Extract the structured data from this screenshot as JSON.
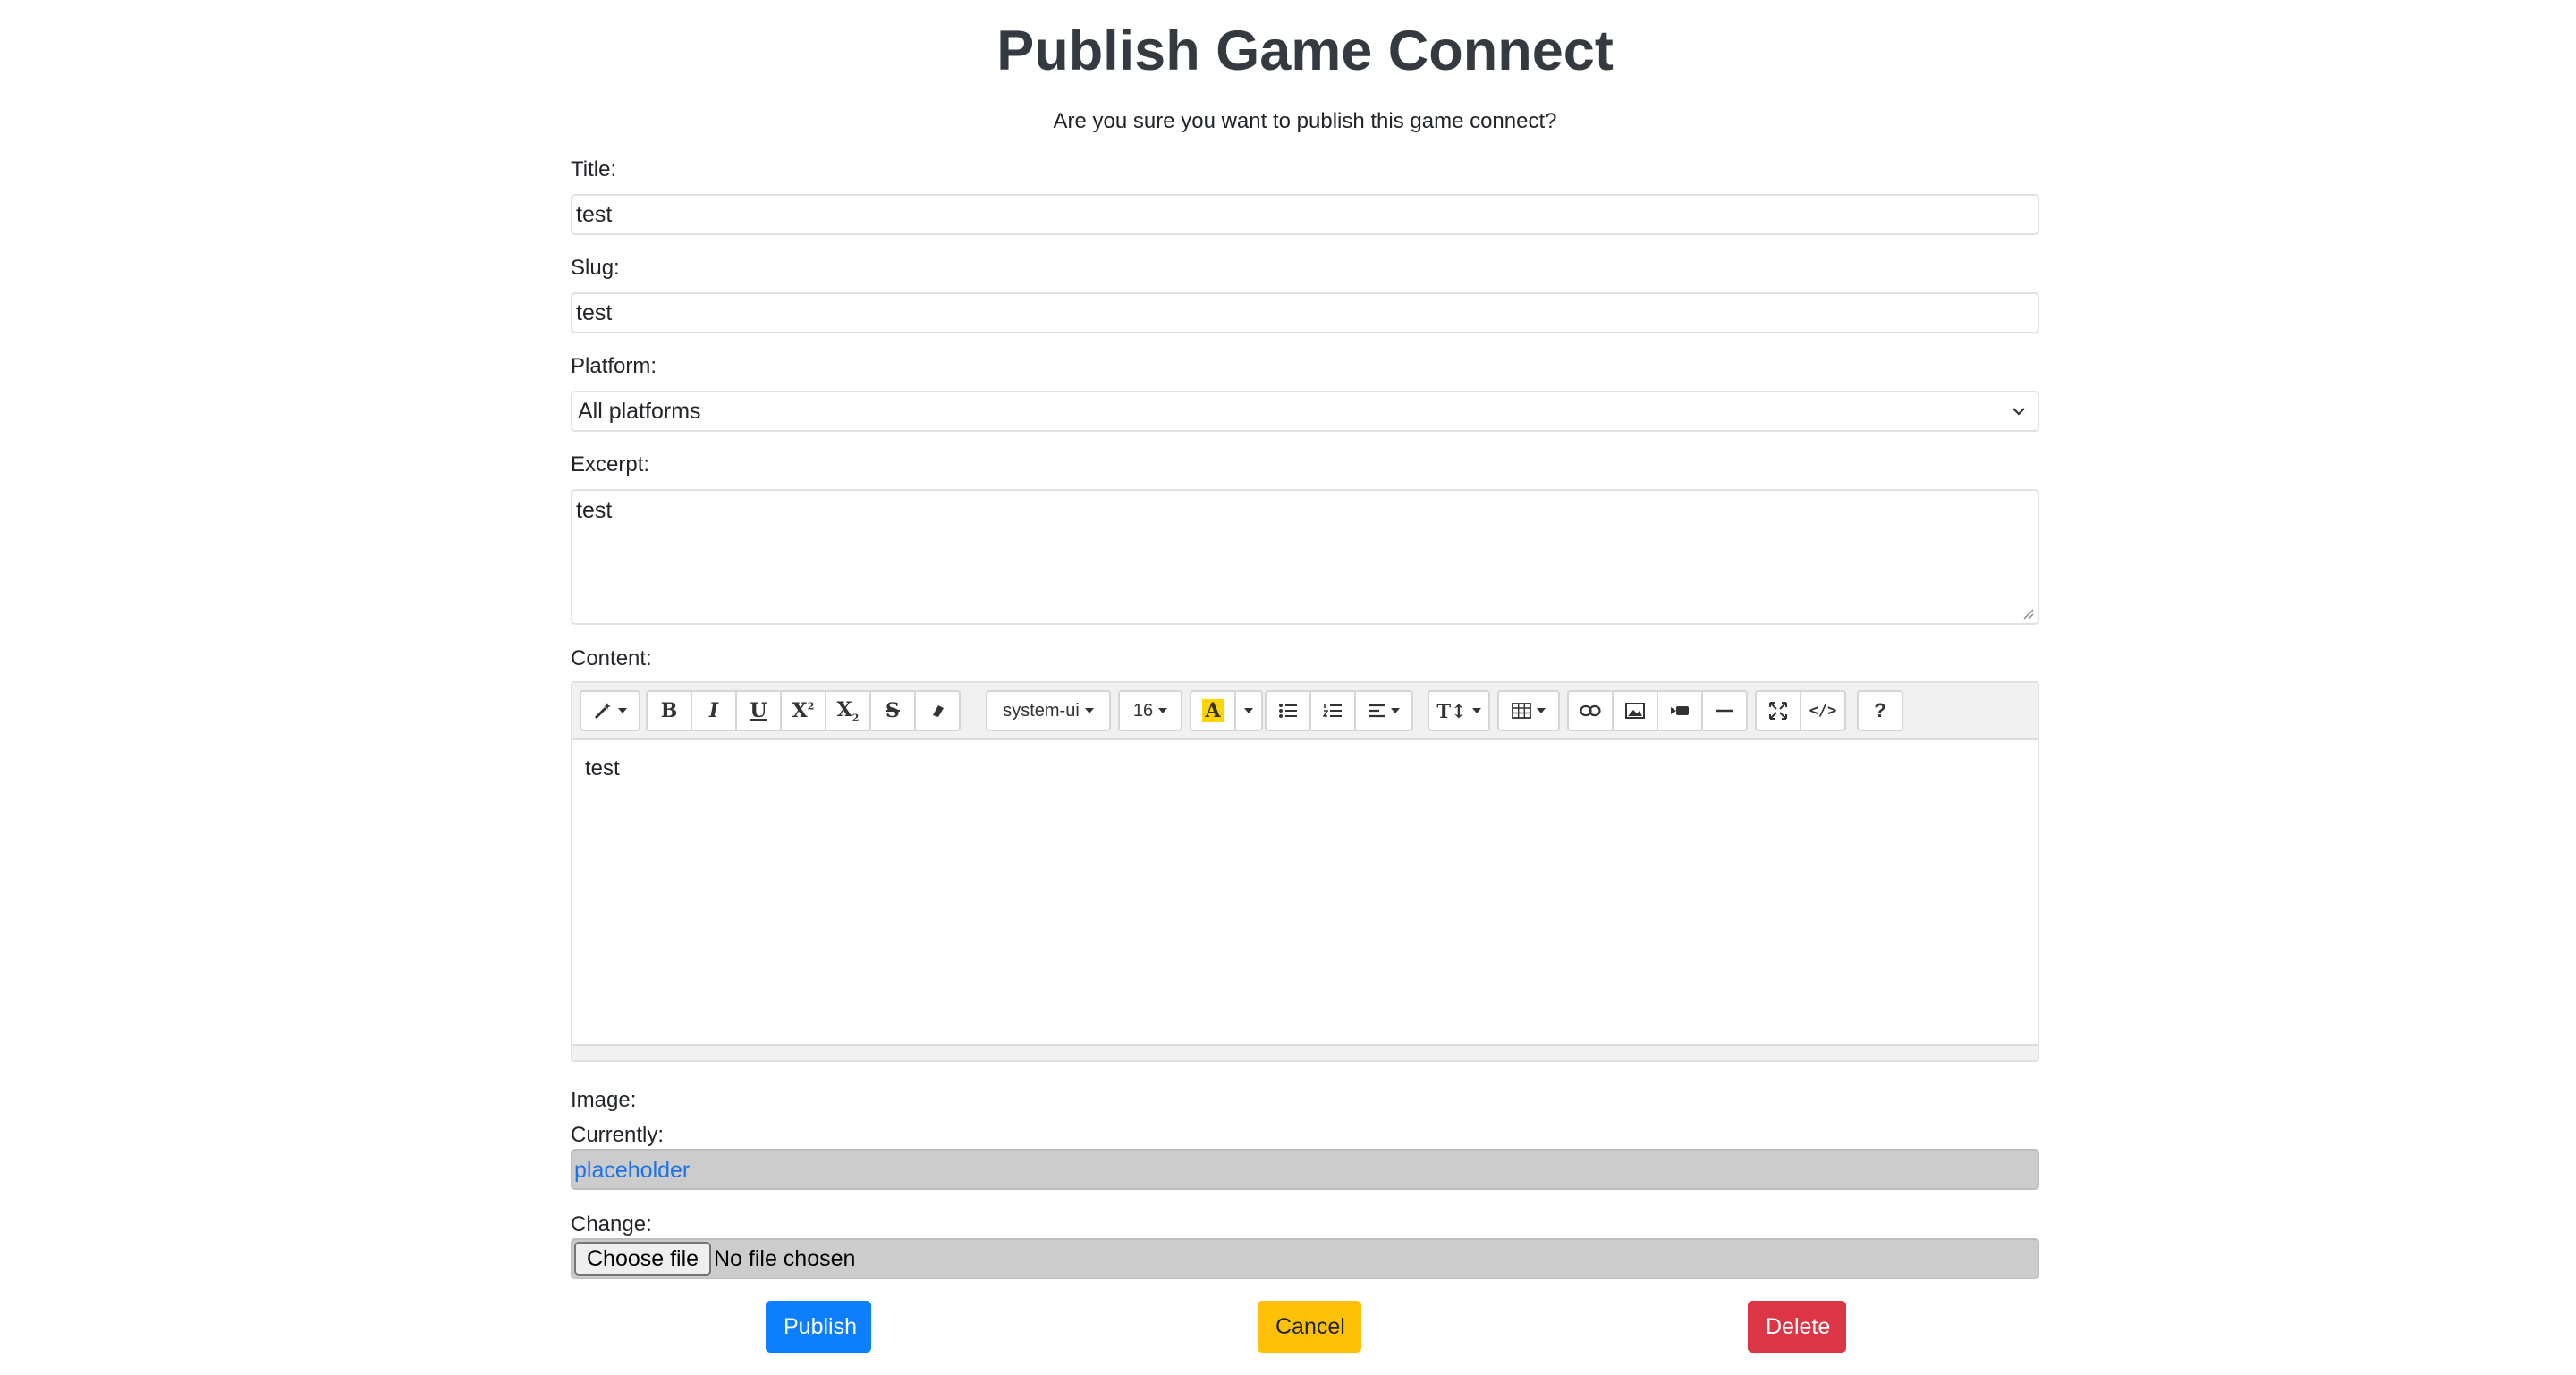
{
  "page": {
    "title": "Publish Game Connect",
    "confirm_text": "Are you sure you want to publish this game connect?"
  },
  "form": {
    "title_label": "Title:",
    "title_value": "test",
    "slug_label": "Slug:",
    "slug_value": "test",
    "platform_label": "Platform:",
    "platform_value": "All platforms",
    "excerpt_label": "Excerpt:",
    "excerpt_value": "test",
    "content_label": "Content:",
    "content_value": "test",
    "image_label": "Image:",
    "currently_label": "Currently:",
    "current_image_link": "placeholder",
    "change_label": "Change:",
    "choose_file_label": "Choose file",
    "no_file_text": "No file chosen"
  },
  "editor": {
    "toolbar": {
      "font_name": "system-ui",
      "font_size": "16",
      "bold": "B",
      "italic": "I",
      "underline": "U",
      "help": "?",
      "highlight_color": "#ffd400",
      "icons": [
        "magic-icon",
        "bold-icon",
        "italic-icon",
        "underline-icon",
        "superscript-icon",
        "subscript-icon",
        "strikethrough-icon",
        "eraser-icon",
        "font-color-icon",
        "unordered-list-icon",
        "ordered-list-icon",
        "align-icon",
        "line-height-icon",
        "table-icon",
        "link-icon",
        "picture-icon",
        "video-icon",
        "horizontal-rule-icon",
        "fullscreen-icon",
        "code-view-icon",
        "help-icon"
      ]
    }
  },
  "actions": {
    "publish": "Publish",
    "cancel": "Cancel",
    "delete": "Delete"
  },
  "colors": {
    "publish": "#0d7ffc",
    "cancel": "#ffc107",
    "delete": "#dc3545",
    "link": "#1a73e8"
  }
}
